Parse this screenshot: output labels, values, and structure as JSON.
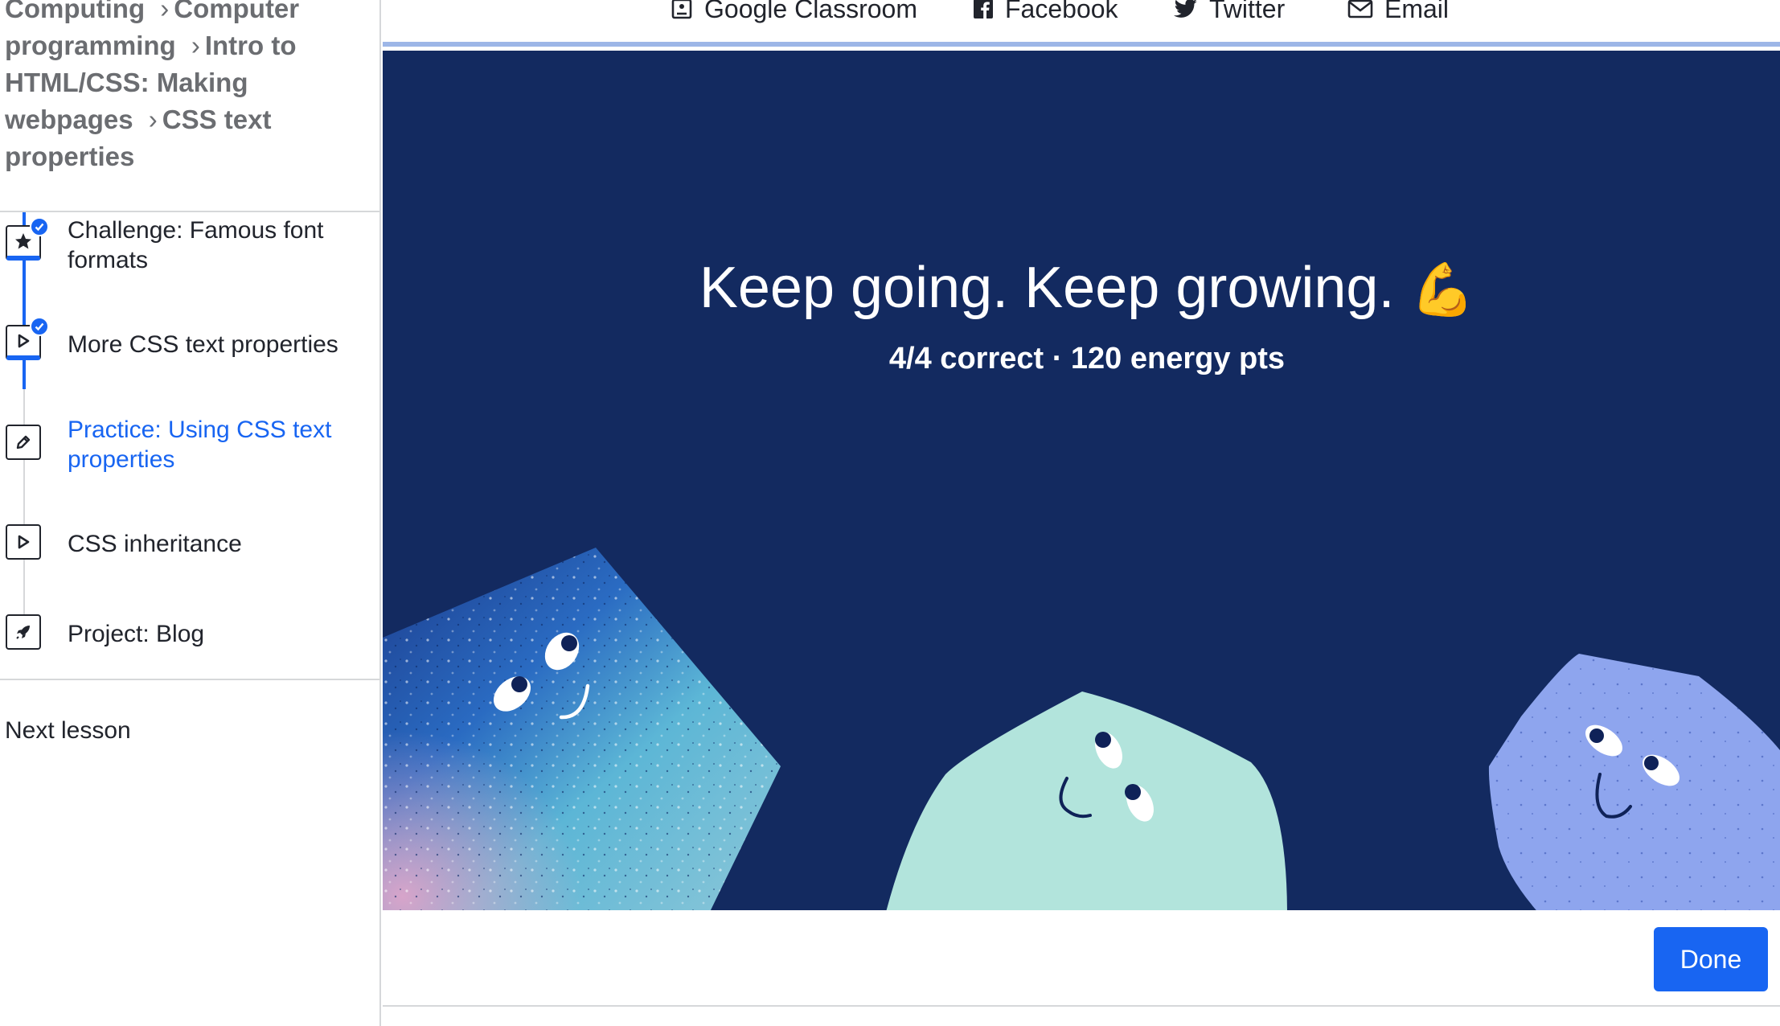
{
  "breadcrumb": [
    {
      "label": "Computing"
    },
    {
      "label": "Computer programming"
    },
    {
      "label": "Intro to HTML/CSS: Making webpages"
    },
    {
      "label": "CSS text properties"
    }
  ],
  "breadcrumb_separator": "›",
  "lessons": [
    {
      "label": "Challenge: Famous font formats",
      "icon": "star-icon",
      "completed": true,
      "active": false
    },
    {
      "label": "More CSS text properties",
      "icon": "play-icon",
      "completed": true,
      "active": false
    },
    {
      "label": "Practice: Using CSS text properties",
      "icon": "pencil-icon",
      "completed": false,
      "active": true
    },
    {
      "label": "CSS inheritance",
      "icon": "play-icon",
      "completed": false,
      "active": false
    },
    {
      "label": "Project: Blog",
      "icon": "rocket-icon",
      "completed": false,
      "active": false
    }
  ],
  "next_lesson_label": "Next lesson",
  "share": {
    "google_classroom": "Google Classroom",
    "facebook": "Facebook",
    "twitter": "Twitter",
    "email": "Email"
  },
  "result": {
    "headline": "Keep going. Keep growing.",
    "emoji": "💪",
    "score": "4/4 correct · 120 energy pts"
  },
  "done_label": "Done",
  "colors": {
    "accent": "#1865f2",
    "panel_background": "#132a60",
    "creature_green": "#b2e4dc",
    "creature_blue": "#8ea5ee"
  }
}
